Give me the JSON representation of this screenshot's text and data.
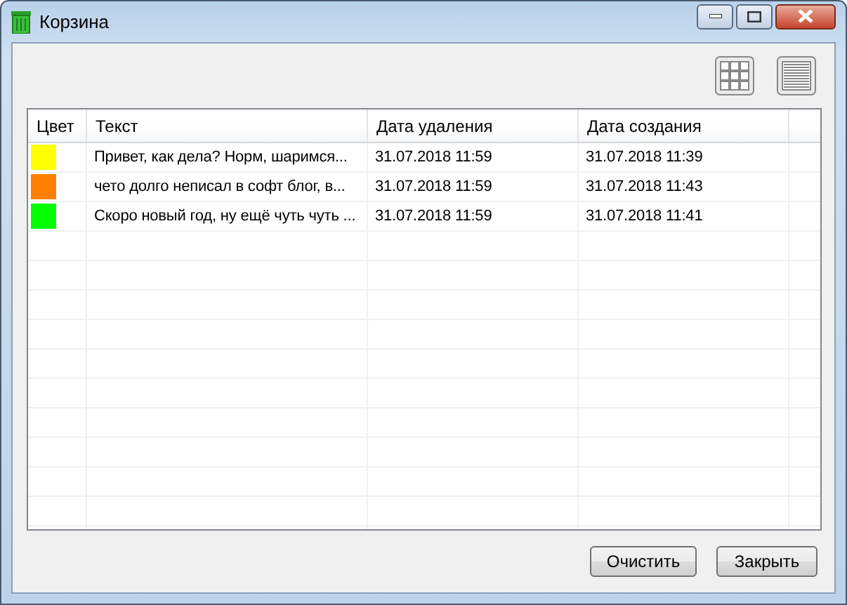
{
  "window": {
    "title": "Корзина"
  },
  "table": {
    "columns": [
      "Цвет",
      "Текст",
      "Дата удаления",
      "Дата создания"
    ],
    "rows": [
      {
        "color": "#ffff00",
        "text": "Привет, как дела? Норм, шаримся...",
        "deleted": "31.07.2018 11:59",
        "created": "31.07.2018 11:39"
      },
      {
        "color": "#ff8000",
        "text": "чето долго неписал в софт блог, в...",
        "deleted": "31.07.2018 11:59",
        "created": "31.07.2018 11:43"
      },
      {
        "color": "#00ff00",
        "text": "Скоро новый год, ну ещё чуть чуть ...",
        "deleted": "31.07.2018 11:59",
        "created": "31.07.2018 11:41"
      }
    ]
  },
  "buttons": [
    "Очистить",
    "Закрыть"
  ]
}
